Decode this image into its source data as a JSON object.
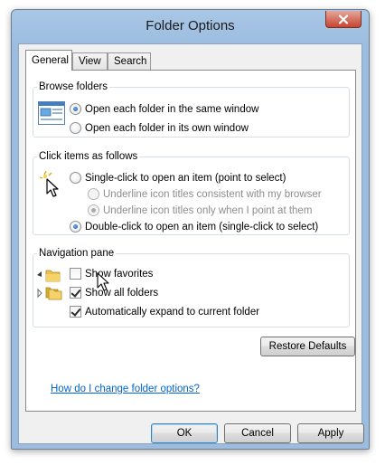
{
  "window": {
    "title": "Folder Options"
  },
  "tabs": [
    {
      "label": "General",
      "active": true
    },
    {
      "label": "View",
      "active": false
    },
    {
      "label": "Search",
      "active": false
    }
  ],
  "browse_folders": {
    "legend": "Browse folders",
    "options": [
      {
        "label": "Open each folder in the same window",
        "selected": true
      },
      {
        "label": "Open each folder in its own window",
        "selected": false
      }
    ]
  },
  "click_items": {
    "legend": "Click items as follows",
    "single_click": {
      "label": "Single-click to open an item (point to select)",
      "selected": false
    },
    "sub_options": [
      {
        "label": "Underline icon titles consistent with my browser",
        "selected": false,
        "enabled": false
      },
      {
        "label": "Underline icon titles only when I point at them",
        "selected": true,
        "enabled": false
      }
    ],
    "double_click": {
      "label": "Double-click to open an item (single-click to select)",
      "selected": true
    }
  },
  "navigation_pane": {
    "legend": "Navigation pane",
    "options": [
      {
        "label": "Show favorites",
        "checked": false
      },
      {
        "label": "Show all folders",
        "checked": true
      },
      {
        "label": "Automatically expand to current folder",
        "checked": true
      }
    ]
  },
  "restore_defaults_label": "Restore Defaults",
  "help_link": "How do I change folder options?",
  "buttons": {
    "ok": "OK",
    "cancel": "Cancel",
    "apply": "Apply"
  },
  "colors": {
    "frame": "#9cbde0",
    "close_button": "#c7452f",
    "link": "#0066cc",
    "dialog_bg": "#f0f0f0"
  }
}
